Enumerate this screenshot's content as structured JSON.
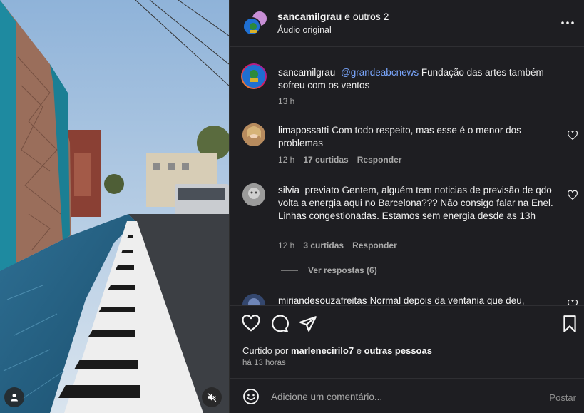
{
  "header": {
    "username": "sancamilgrau",
    "and_others": "e outros 2",
    "audio": "Áudio original"
  },
  "caption": {
    "username": "sancamilgrau",
    "mention": "@grandeabcnews",
    "text": "Fundação das artes também sofreu com os ventos",
    "time": "13 h"
  },
  "comments": [
    {
      "username": "limapossatti",
      "text": "Com todo respeito, mas esse é o menor dos problemas",
      "time": "12 h",
      "likes": "17 curtidas",
      "reply": "Responder"
    },
    {
      "username": "silvia_previato",
      "text": "Gentem, alguém tem noticias de previsão de qdo volta a energia aqui no Barcelona??? Não consigo falar na Enel. Linhas congestionadas. Estamos sem energia desde as 13h",
      "time": "12 h",
      "likes": "3 curtidas",
      "reply": "Responder"
    },
    {
      "username": "miriandesouzafreitas",
      "text": "Normal depois da ventania que deu,",
      "time": "",
      "likes": "",
      "reply": ""
    }
  ],
  "view_replies": "Ver respostas (6)",
  "likes": {
    "prefix": "Curtido por",
    "user": "marlenecirilo7",
    "joiner": "e",
    "others": "outras pessoas"
  },
  "posted_ago": "há 13 horas",
  "composer": {
    "placeholder": "Adicione um comentário...",
    "post_label": "Postar"
  },
  "colors": {
    "panel_bg": "#1e1e22",
    "mention": "#7aa7ff",
    "muted_text": "#a8a8a8"
  },
  "icons": {
    "more": "more-icon",
    "like": "heart-icon",
    "comment": "comment-icon",
    "share": "send-icon",
    "save": "bookmark-icon",
    "emoji": "emoji-icon",
    "user_tag": "user-icon",
    "mute": "muted-speaker-icon"
  }
}
